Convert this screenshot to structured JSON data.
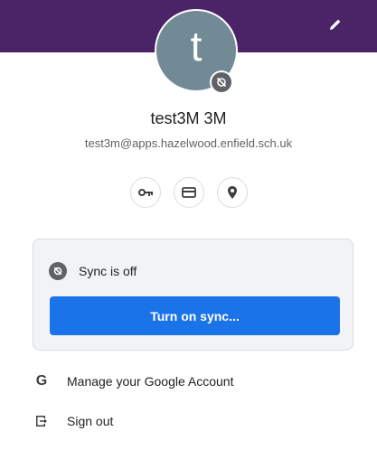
{
  "profile": {
    "avatar_letter": "t",
    "name": "test3M 3M",
    "email": "test3m@apps.hazelwood.enfield.sch.uk",
    "banner_color": "#4a2467",
    "avatar_color": "#728a95"
  },
  "icons": {
    "edit": "pencil-icon",
    "passwords": "key-icon",
    "payments": "credit-card-icon",
    "addresses": "location-pin-icon",
    "sync_badge": "sync-off-icon"
  },
  "sync": {
    "status": "Sync is off",
    "button_label": "Turn on sync...",
    "button_color": "#1a73e8"
  },
  "menu": {
    "manage_account": "Manage your Google Account",
    "sign_out": "Sign out"
  }
}
